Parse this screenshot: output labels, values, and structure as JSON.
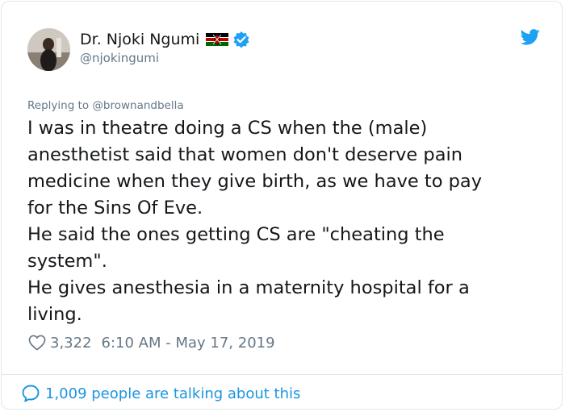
{
  "author": {
    "name": "Dr. Njoki Ngumi",
    "handle": "@njokingumi"
  },
  "reply": {
    "text": "Replying to @brownandbella"
  },
  "tweet": {
    "lines": [
      "I was in theatre doing a CS when the (male)",
      "anesthetist said that women don't deserve pain",
      "medicine when they give birth, as we have to pay",
      "for the Sins Of Eve.",
      "He said the ones getting CS are \"cheating the",
      "system\".",
      "He gives anesthesia in a maternity hospital for a",
      "living."
    ]
  },
  "meta": {
    "likes": "3,322",
    "timestamp": "6:10 AM - May 17, 2019"
  },
  "footer": {
    "talking": "1,009 people are talking about this"
  },
  "icons": {
    "avatar": "avatar",
    "flag": "kenya-flag-icon",
    "verified": "verified-badge-icon",
    "twitter": "twitter-bird-icon",
    "heart": "heart-icon",
    "comment": "speech-bubble-icon"
  },
  "colors": {
    "accent": "#1da1f2",
    "link": "#1b95e0",
    "muted": "#657786",
    "text": "#14171a",
    "border": "#e1e8ed"
  }
}
